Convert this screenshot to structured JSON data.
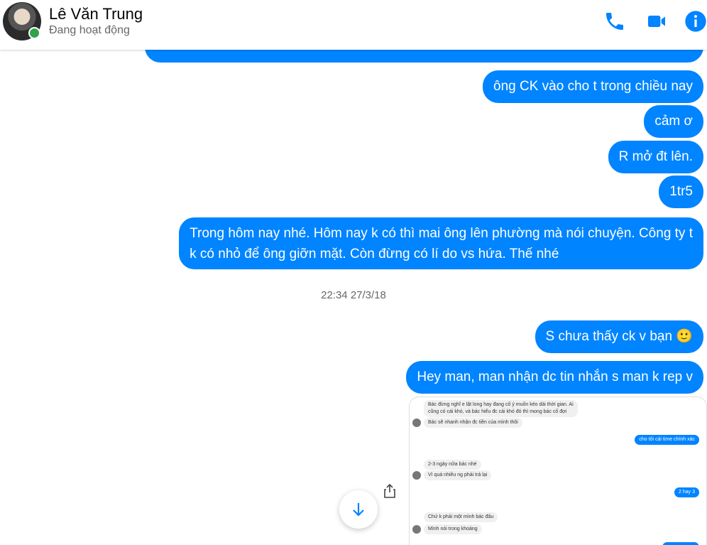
{
  "header": {
    "name": "Lê Văn Trung",
    "status": "Đang hoạt động",
    "accent": "#0084ff",
    "online_color": "#31a24c",
    "icons": [
      "phone-icon",
      "video-icon",
      "info-icon"
    ]
  },
  "messages": [
    {
      "text": "ông CK vào cho t trong chiều nay"
    },
    {
      "text": "cảm ơ"
    },
    {
      "text": "R mở đt lên."
    },
    {
      "text": "1tr5"
    },
    {
      "lines": [
        "Trong hôm nay nhé. Hôm nay k có thì mai ông lên phường mà nói chuyện. Công ty t",
        "k có nhỏ để ông giỡn mặt. Còn đừng có lí do vs hứa. Thế nhé"
      ]
    },
    {
      "text": "S chưa thấy ck v bạn",
      "emoji": "🙂"
    },
    {
      "text": "Hey man, man nhận dc tin nhắn s man k rep v"
    }
  ],
  "timestamp": "22:34 27/3/18",
  "screenshot": {
    "received_1": [
      "Bác đừng nghĩ e lật long hay đang cố ý muốn kéo dài thời gian. Ai",
      "cũng có cái khó, và bác hiểu đc cái khó đó thì mong bác cố đợi"
    ],
    "received_2": "Bác sẽ nhanh nhận đc tiền của mình thôi",
    "sent_1": "cho tôi cái time chính xác",
    "received_3": "2-3 ngày nữa bác nhé",
    "received_4": "Vì quá nhiều ng phải trả lại",
    "sent_2": "2 hay 3",
    "received_5": "Chứ k phải một mình bác đâu",
    "received_6": "Mình nói trong khoảng"
  }
}
